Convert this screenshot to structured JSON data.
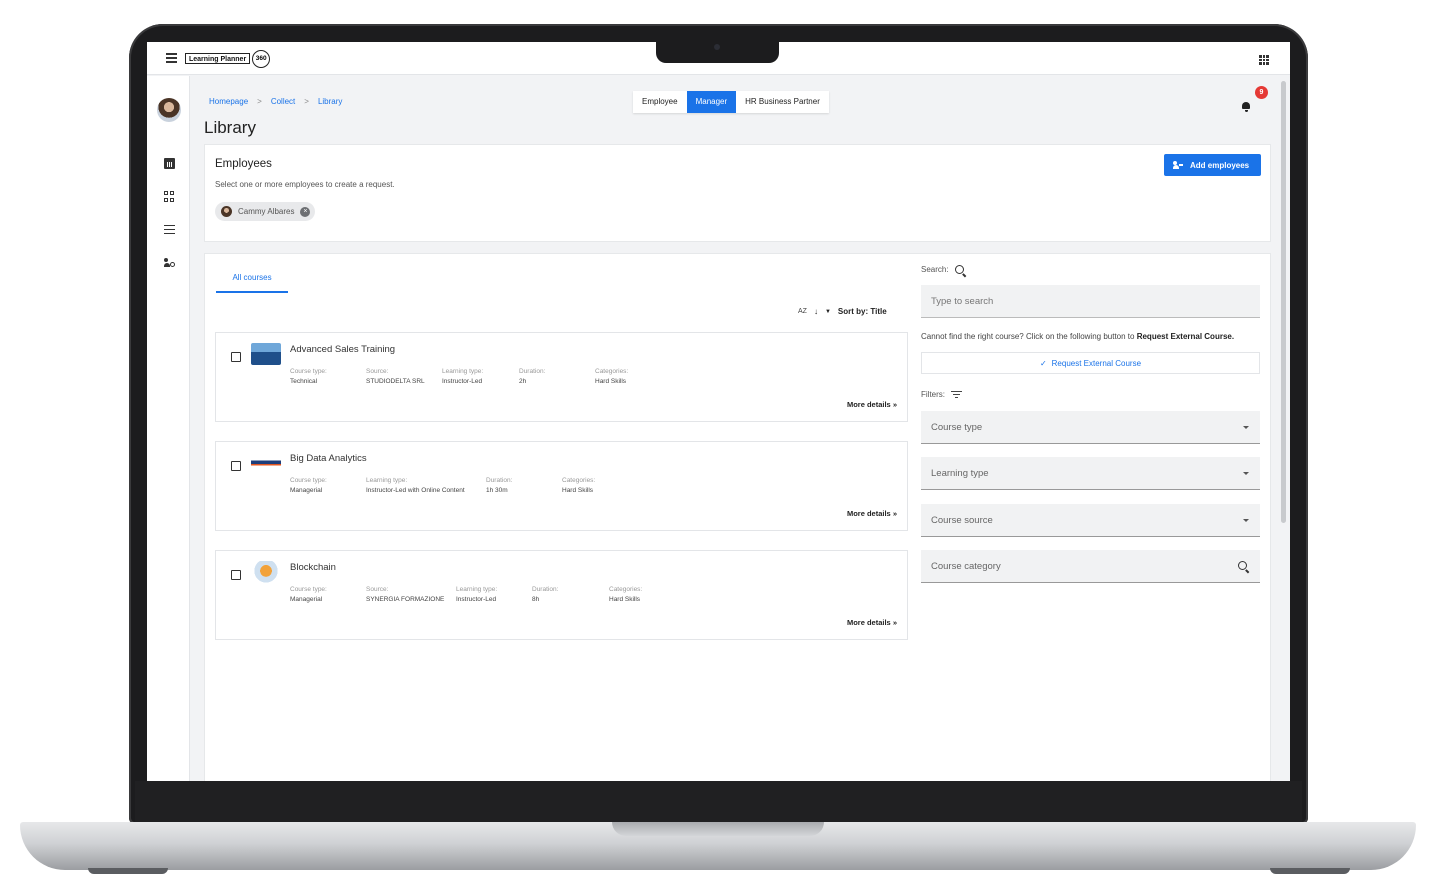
{
  "app": {
    "logo_text": "Learning Planner",
    "logo_badge": "360",
    "icons": [
      "menu-icon",
      "apps-grid-icon",
      "bell-icon",
      "chart-icon",
      "dashboard-icon",
      "list-icon",
      "people-settings-icon"
    ]
  },
  "breadcrumb": [
    {
      "label": "Homepage"
    },
    {
      "label": "Collect"
    },
    {
      "label": "Library"
    }
  ],
  "breadcrumb_sep": ">",
  "page_title": "Library",
  "roles": [
    "Employee",
    "Manager",
    "HR Business Partner"
  ],
  "active_role": "Manager",
  "notifications": {
    "count": "9"
  },
  "employees": {
    "title": "Employees",
    "subtitle": "Select one or more employees to create a request.",
    "add_button": "Add employees",
    "selected": [
      {
        "name": "Cammy Albares"
      }
    ]
  },
  "courses": {
    "tab": "All courses",
    "sort_az": "AZ",
    "sort_label": "Sort by: Title",
    "more_label": "More details »",
    "items": [
      {
        "title": "Advanced Sales Training",
        "fields": [
          {
            "label": "Course type:",
            "value": "Technical"
          },
          {
            "label": "Source:",
            "value": "STUDIODELTA SRL"
          },
          {
            "label": "Learning type:",
            "value": "Instructor-Led"
          },
          {
            "label": "Duration:",
            "value": "2h"
          },
          {
            "label": "Categories:",
            "value": "Hard Skills"
          }
        ]
      },
      {
        "title": "Big Data Analytics",
        "fields": [
          {
            "label": "Course type:",
            "value": "Managerial"
          },
          {
            "label": "Learning type:",
            "value": "Instructor-Led with Online Content"
          },
          {
            "label": "Duration:",
            "value": "1h 30m"
          },
          {
            "label": "Categories:",
            "value": "Hard Skills"
          }
        ]
      },
      {
        "title": "Blockchain",
        "fields": [
          {
            "label": "Course type:",
            "value": "Managerial"
          },
          {
            "label": "Source:",
            "value": "SYNERGIA FORMAZIONE"
          },
          {
            "label": "Learning type:",
            "value": "Instructor-Led"
          },
          {
            "label": "Duration:",
            "value": "8h"
          },
          {
            "label": "Categories:",
            "value": "Hard Skills"
          }
        ]
      }
    ]
  },
  "search": {
    "label": "Search:",
    "placeholder": "Type to search",
    "external_text": "Cannot find the right course? Click on the following button to",
    "external_bold": "Request External Course.",
    "external_button": "Request External Course"
  },
  "filters": {
    "label": "Filters:",
    "options": [
      "Course type",
      "Learning type",
      "Course source",
      "Course category"
    ]
  },
  "colors": {
    "accent": "#1a73e8",
    "badge": "#e53935"
  }
}
